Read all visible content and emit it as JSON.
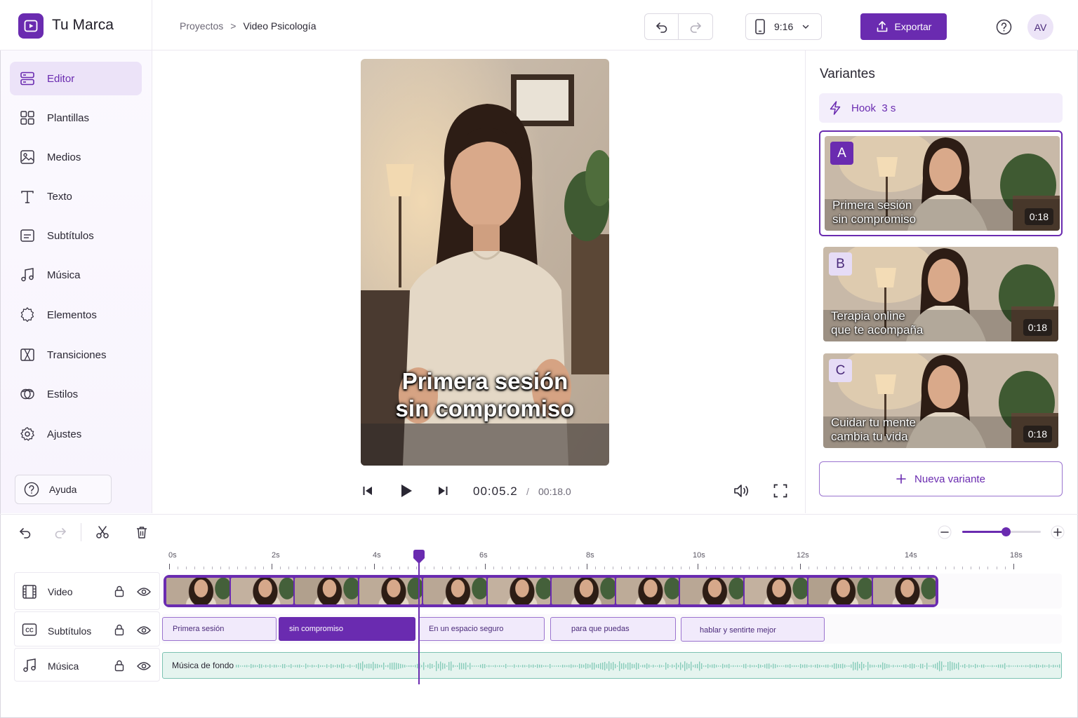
{
  "app": {
    "brand": "Tu Marca"
  },
  "breadcrumb": {
    "parent": "Proyectos",
    "separator": ">",
    "current": "Video Psicología"
  },
  "toolbar": {
    "aspect_ratio": "9:16",
    "export_label": "Exportar",
    "avatar_initials": "AV"
  },
  "sidebar": {
    "items": [
      {
        "label": "Editor",
        "icon": "editor-icon",
        "active": true
      },
      {
        "label": "Plantillas",
        "icon": "templates-icon"
      },
      {
        "label": "Medios",
        "icon": "media-icon"
      },
      {
        "label": "Texto",
        "icon": "text-icon"
      },
      {
        "label": "Subtítulos",
        "icon": "subtitles-icon"
      },
      {
        "label": "Música",
        "icon": "music-icon"
      },
      {
        "label": "Elementos",
        "icon": "elements-icon"
      },
      {
        "label": "Transiciones",
        "icon": "transitions-icon"
      },
      {
        "label": "Estilos",
        "icon": "styles-icon"
      },
      {
        "label": "Ajustes",
        "icon": "settings-icon"
      }
    ],
    "help_label": "Ayuda"
  },
  "preview": {
    "caption_line1": "Primera sesión",
    "caption_line2": "sin compromiso",
    "current_time": "00:05.2",
    "time_separator": "/",
    "total_time": "00:18.0"
  },
  "variants": {
    "title": "Variantes",
    "hook_label": "Hook  3 s",
    "items": [
      {
        "letter": "A",
        "line1": "Primera sesión",
        "line2": "sin compromiso",
        "duration": "0:18",
        "selected": true
      },
      {
        "letter": "B",
        "line1": "Terapia online",
        "line2": "que te acompaña",
        "duration": "0:18",
        "selected": false
      },
      {
        "letter": "C",
        "line1": "Cuidar tu mente",
        "line2": "cambia tu vida",
        "duration": "0:18",
        "selected": false
      }
    ],
    "new_variant_label": "Nueva variante"
  },
  "timeline": {
    "ruler_labels": [
      "0s",
      "2s",
      "4s",
      "6s",
      "8s",
      "10s",
      "12s",
      "14s",
      "18s"
    ],
    "zoom_level": 0.55,
    "tracks": {
      "video_label": "Video",
      "subtitles_label": "Subtítulos",
      "music_label": "Música"
    },
    "subtitle_clips": [
      {
        "text": "Primera sesión",
        "active": false
      },
      {
        "text": "sin compromiso",
        "active": true
      },
      {
        "text": "En un espacio seguro",
        "active": false
      },
      {
        "text": "para que puedas",
        "active": false
      },
      {
        "text": "hablar y sentirte mejor",
        "active": false
      }
    ],
    "music_clip_label": "Música de fondo"
  },
  "colors": {
    "accent": "#6a2bb0",
    "accent_light": "#ece3f8",
    "music": "#7cc2b2"
  }
}
